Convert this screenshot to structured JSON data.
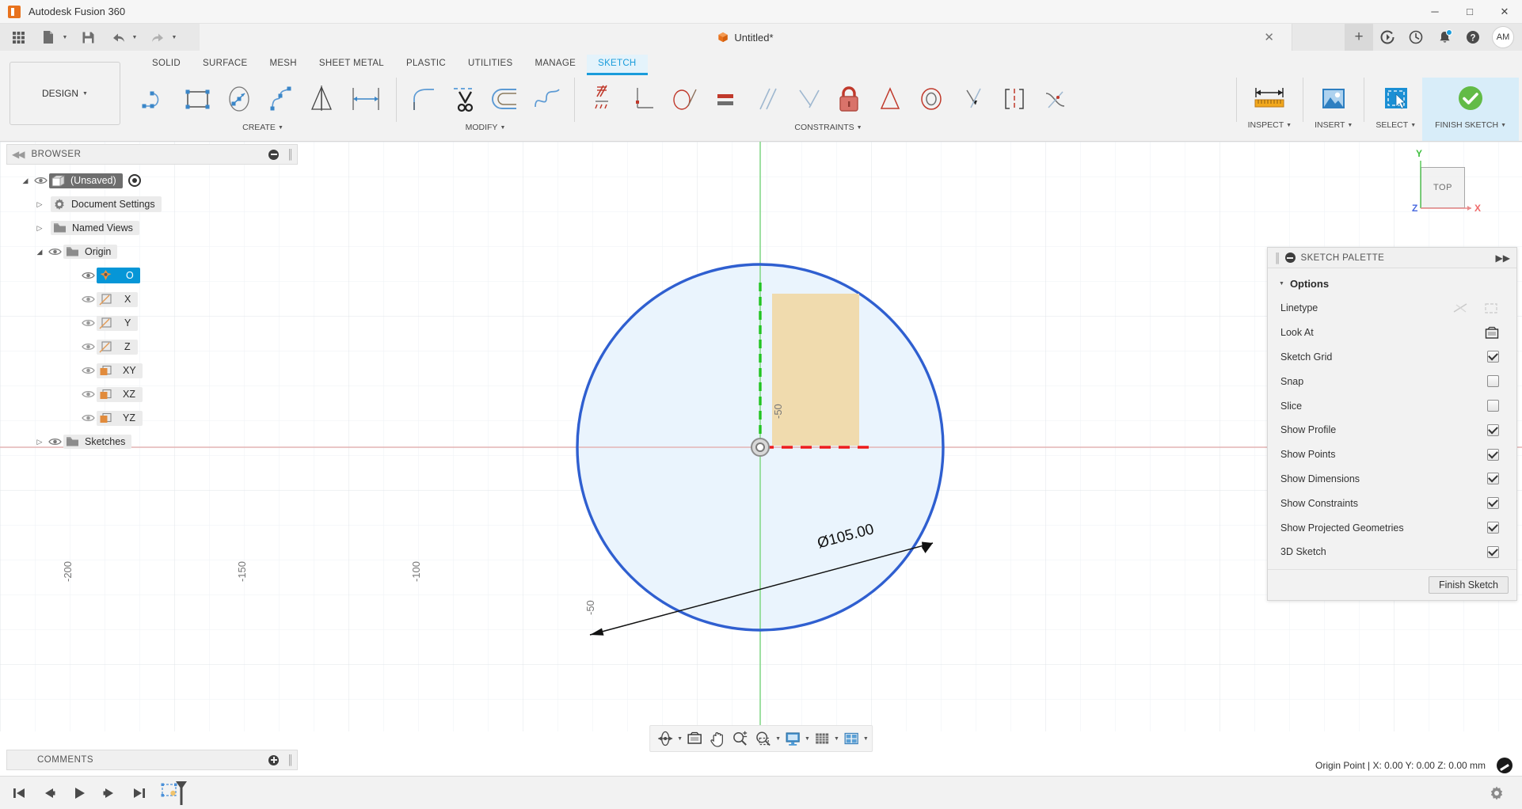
{
  "window": {
    "app_title": "Autodesk Fusion 360",
    "minimize": "─",
    "maximize": "□",
    "close": "✕"
  },
  "quickbar": {
    "grid_icon": "app-grid-icon",
    "new_icon": "new-document-icon",
    "save_icon": "save-icon",
    "undo_icon": "undo-icon",
    "redo_icon": "redo-icon",
    "caret": "▼"
  },
  "doc_tab": {
    "name": "Untitled*",
    "close": "✕",
    "icon": "cube-icon"
  },
  "header_right": {
    "add_tab": "+",
    "items": [
      {
        "name": "job-status-icon"
      },
      {
        "name": "history-clock-icon"
      },
      {
        "name": "notifications-bell-icon",
        "badge": true
      },
      {
        "name": "help-icon"
      }
    ],
    "avatar_initials": "AM"
  },
  "ribbon": {
    "workspace": {
      "label": "DESIGN",
      "caret": "▼"
    },
    "tabs": [
      {
        "label": "SOLID",
        "active": false
      },
      {
        "label": "SURFACE",
        "active": false
      },
      {
        "label": "MESH",
        "active": false
      },
      {
        "label": "SHEET METAL",
        "active": false
      },
      {
        "label": "PLASTIC",
        "active": false
      },
      {
        "label": "UTILITIES",
        "active": false
      },
      {
        "label": "MANAGE",
        "active": false
      },
      {
        "label": "SKETCH",
        "active": true
      }
    ],
    "panels": [
      {
        "label": "CREATE",
        "caret": "▼",
        "tools": [
          "line-icon",
          "rectangle-icon",
          "circle-icon",
          "spline-icon",
          "mirror-icon",
          "offset-distance-icon"
        ]
      },
      {
        "label": "MODIFY",
        "caret": "▼",
        "tools": [
          "fillet-icon",
          "trim-scissors-icon",
          "offset-icon",
          "break-curve-icon"
        ]
      },
      {
        "label": "CONSTRAINTS",
        "caret": "▼",
        "tools": [
          "horizontal-vertical-constraint-icon",
          "perpendicular-constraint-icon",
          "tangent-constraint-icon",
          "equal-constraint-icon",
          "parallel-constraint-icon",
          "coincident-constraint-icon",
          "fix-lock-icon",
          "midpoint-constraint-icon",
          "concentric-constraint-icon",
          "collinear-constraint-icon",
          "symmetry-constraint-icon",
          "curvature-constraint-icon"
        ]
      }
    ],
    "right_groups": [
      {
        "label": "INSPECT",
        "caret": "▼",
        "icon": "measure-ruler-icon",
        "highlight": false
      },
      {
        "label": "INSERT",
        "caret": "▼",
        "icon": "insert-image-icon",
        "highlight": false
      },
      {
        "label": "SELECT",
        "caret": "▼",
        "icon": "select-cursor-icon",
        "highlight": false
      },
      {
        "label": "FINISH SKETCH",
        "caret": "▼",
        "icon": "green-check-icon",
        "highlight": true
      }
    ]
  },
  "browser": {
    "title": "BROWSER",
    "collapse_icon": "collapse-left-icon",
    "tree": [
      {
        "label": "(Unsaved)",
        "level": 0,
        "tri": "open",
        "eye": true,
        "icon": "document-cube-icon",
        "selected": "dark",
        "radio": true
      },
      {
        "label": "Document Settings",
        "level": 1,
        "tri": "closed",
        "eye": false,
        "icon": "gear-icon"
      },
      {
        "label": "Named Views",
        "level": 1,
        "tri": "closed",
        "eye": false,
        "icon": "folder-icon"
      },
      {
        "label": "Origin",
        "level": 1,
        "tri": "open",
        "eye": true,
        "icon": "origin-folder-icon"
      },
      {
        "label": "O",
        "level": 2,
        "tri": "none",
        "eye": true,
        "icon": "origin-point-icon",
        "selected": "blue"
      },
      {
        "label": "X",
        "level": 2,
        "tri": "none",
        "eye": true,
        "icon": "axis-icon"
      },
      {
        "label": "Y",
        "level": 2,
        "tri": "none",
        "eye": true,
        "icon": "axis-icon"
      },
      {
        "label": "Z",
        "level": 2,
        "tri": "none",
        "eye": true,
        "icon": "axis-icon"
      },
      {
        "label": "XY",
        "level": 2,
        "tri": "none",
        "eye": true,
        "icon": "plane-icon"
      },
      {
        "label": "XZ",
        "level": 2,
        "tri": "none",
        "eye": true,
        "icon": "plane-icon"
      },
      {
        "label": "YZ",
        "level": 2,
        "tri": "none",
        "eye": true,
        "icon": "plane-icon"
      },
      {
        "label": "Sketches",
        "level": 1,
        "tri": "closed",
        "eye": true,
        "icon": "folder-icon"
      }
    ]
  },
  "canvas": {
    "axis_labels": [
      "-200",
      "-150",
      "-100",
      "-50"
    ],
    "dimension_text": "Ø105.00",
    "viewcube": {
      "face": "TOP",
      "axis_x": "X",
      "axis_y": "Y",
      "axis_z": "Z"
    },
    "colors": {
      "circle_stroke": "#2f5fd0",
      "profile_fill": "#eaf4fd",
      "x_axis": "#d88a8a",
      "y_axis": "#23c423",
      "dim_red": "#ee1c1c",
      "profile_highlight": "#f0dbae"
    }
  },
  "palette": {
    "title": "SKETCH PALETTE",
    "expand_icon": "expand-right-icon",
    "section": {
      "label": "Options",
      "caret": "▼"
    },
    "rows": [
      {
        "label": "Linetype",
        "control": "icons",
        "icons": [
          "construction-line-icon",
          "centerline-icon"
        ]
      },
      {
        "label": "Look At",
        "control": "icon",
        "icons": [
          "look-at-icon"
        ]
      },
      {
        "label": "Sketch Grid",
        "control": "checkbox",
        "checked": true
      },
      {
        "label": "Snap",
        "control": "checkbox",
        "checked": false
      },
      {
        "label": "Slice",
        "control": "checkbox",
        "checked": false
      },
      {
        "label": "Show Profile",
        "control": "checkbox",
        "checked": true
      },
      {
        "label": "Show Points",
        "control": "checkbox",
        "checked": true
      },
      {
        "label": "Show Dimensions",
        "control": "checkbox",
        "checked": true
      },
      {
        "label": "Show Constraints",
        "control": "checkbox",
        "checked": true
      },
      {
        "label": "Show Projected Geometries",
        "control": "checkbox",
        "checked": true
      },
      {
        "label": "3D Sketch",
        "control": "checkbox",
        "checked": true
      }
    ],
    "finish_button": "Finish Sketch"
  },
  "navbar": {
    "items": [
      {
        "name": "orbit-icon",
        "caret": true
      },
      {
        "name": "look-at-icon",
        "caret": false
      },
      {
        "name": "pan-hand-icon",
        "caret": false
      },
      {
        "name": "zoom-icon",
        "caret": false
      },
      {
        "name": "fit-zoom-window-icon",
        "caret": true
      },
      {
        "name": "display-settings-icon",
        "caret": true
      },
      {
        "name": "grid-snaps-icon",
        "caret": true
      },
      {
        "name": "viewport-layout-icon",
        "caret": true
      }
    ],
    "caret": "▼"
  },
  "comments": {
    "title": "COMMENTS",
    "add_icon": "add-comment-icon"
  },
  "status": {
    "text": "Origin Point | X: 0.00 Y: 0.00 Z: 0.00 mm",
    "brand_icon": "autodesk-logo-icon"
  },
  "timeline": {
    "buttons": [
      "skip-to-start-icon",
      "step-backward-icon",
      "play-icon",
      "step-forward-icon",
      "skip-to-end-icon"
    ],
    "marker": "sketch-timeline-marker-icon",
    "settings": "settings-gear-icon"
  }
}
